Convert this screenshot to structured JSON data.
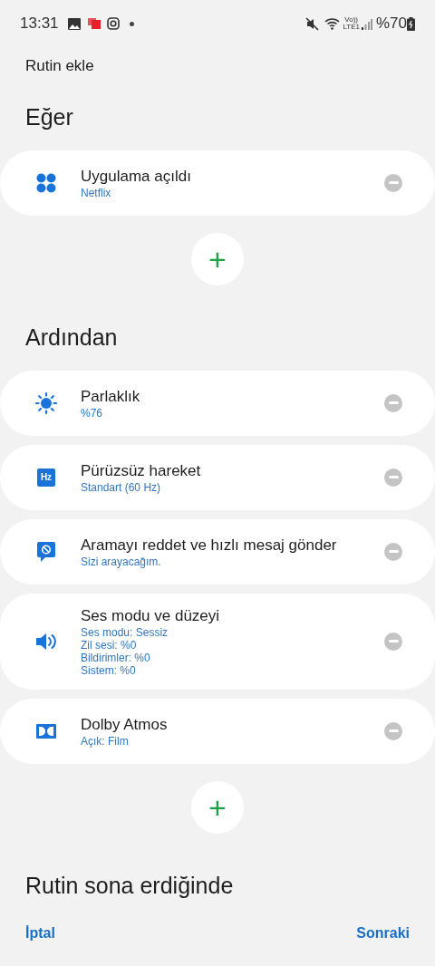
{
  "status_bar": {
    "time": "13:31",
    "volte": "Vo))",
    "lte": "LTE1",
    "battery": "%70"
  },
  "title": "Rutin ekle",
  "sections": [
    {
      "heading": "Eğer",
      "items": [
        {
          "kind": "apps",
          "title": "Uygulama açıldı",
          "details": [
            "Netflix"
          ]
        }
      ],
      "add": "+"
    },
    {
      "heading": "Ardından",
      "items": [
        {
          "kind": "brightness",
          "title": "Parlaklık",
          "details": [
            "%76"
          ]
        },
        {
          "kind": "hz",
          "icon_label": "Hz",
          "title": "Pürüzsüz hareket",
          "details": [
            "Standart (60 Hz)"
          ]
        },
        {
          "kind": "message",
          "title": "Aramayı reddet ve hızlı mesaj gönder",
          "details": [
            "Sizi arayacağım."
          ]
        },
        {
          "kind": "volume",
          "title": "Ses modu ve düzeyi",
          "details": [
            "Ses modu: Sessiz",
            "Zil sesi: %0",
            "Bildirimler: %0",
            "Sistem: %0"
          ]
        },
        {
          "kind": "dolby",
          "title": "Dolby Atmos",
          "details": [
            "Açık: Film"
          ]
        }
      ],
      "add": "+"
    },
    {
      "heading": "Rutin sona erdiğinde"
    }
  ],
  "footer": {
    "cancel": "İptal",
    "next": "Sonraki"
  }
}
